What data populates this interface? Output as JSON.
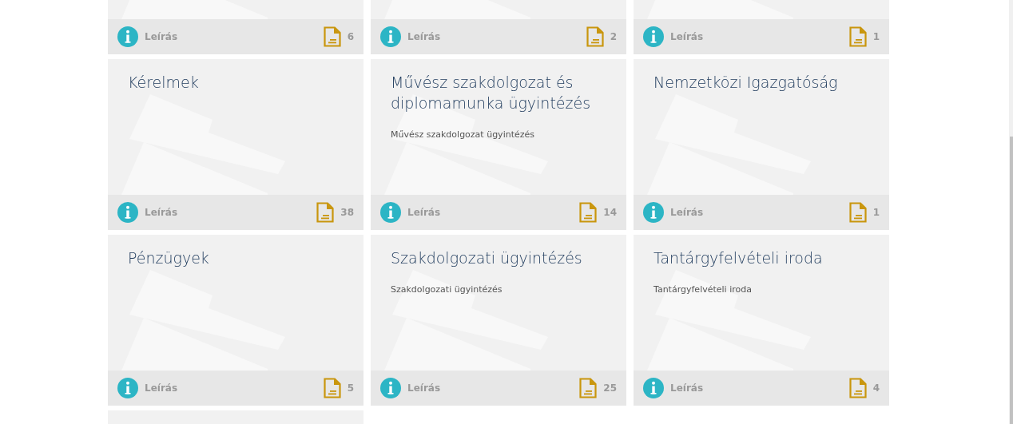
{
  "cards": [
    {
      "kind": "card",
      "info": "Leírás",
      "count": "6"
    },
    {
      "kind": "card",
      "info": "Leírás",
      "count": "2"
    },
    {
      "kind": "card",
      "info": "Leírás",
      "count": "1"
    },
    {
      "kind": "card",
      "title": "Kérelmek",
      "info": "Leírás",
      "count": "38"
    },
    {
      "kind": "card",
      "title": "Művész szakdolgozat és diplomamunka ügyintézés",
      "subtitle": "Művész szakdolgozat ügyintézés",
      "info": "Leírás",
      "count": "14"
    },
    {
      "kind": "card",
      "title": "Nemzetközi Igazgatóság",
      "info": "Leírás",
      "count": "1"
    },
    {
      "kind": "card",
      "title": "Pénzügyek",
      "info": "Leírás",
      "count": "5"
    },
    {
      "kind": "card",
      "title": "Szakdolgozati ügyintézés",
      "subtitle": "Szakdolgozati ügyintézés",
      "info": "Leírás",
      "count": "25"
    },
    {
      "kind": "card",
      "title": "Tantárgyfelvételi iroda",
      "subtitle": "Tantárgyfelvételi iroda",
      "info": "Leírás",
      "count": "4"
    },
    {
      "kind": "cut"
    }
  ]
}
